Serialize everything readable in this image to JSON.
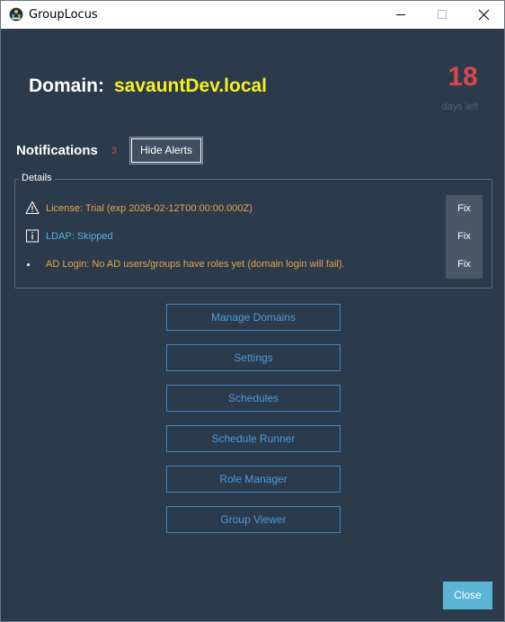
{
  "window": {
    "title": "GroupLocus"
  },
  "header": {
    "domain_label": "Domain:",
    "domain_value": "savauntDev.local",
    "days_left_value": "18",
    "days_left_label": "days left"
  },
  "notifications": {
    "title": "Notifications",
    "count": "3",
    "hide_button": "Hide Alerts"
  },
  "details": {
    "legend": "Details",
    "alerts": [
      {
        "icon": "warning-icon",
        "text": "License: Trial (exp 2026-02-12T00:00:00.000Z)",
        "fix": "Fix"
      },
      {
        "icon": "info-icon",
        "text": "LDAP: Skipped",
        "fix": "Fix"
      },
      {
        "icon": "bullet-icon",
        "text": "AD Login: No AD users/groups have roles yet (domain login will fail).",
        "fix": "Fix"
      }
    ]
  },
  "nav": {
    "buttons": [
      "Manage Domains",
      "Settings",
      "Schedules",
      "Schedule Runner",
      "Role Manager",
      "Group Viewer"
    ]
  },
  "footer": {
    "close_button": "Close"
  },
  "colors": {
    "background": "#2c3b4b",
    "domain_value": "#f7f01e",
    "days_left": "#d8484a",
    "alert_warning": "#e9a24a",
    "alert_info": "#4fb0e4",
    "nav_border": "#3e86c9",
    "close_button": "#5ab4d6"
  }
}
